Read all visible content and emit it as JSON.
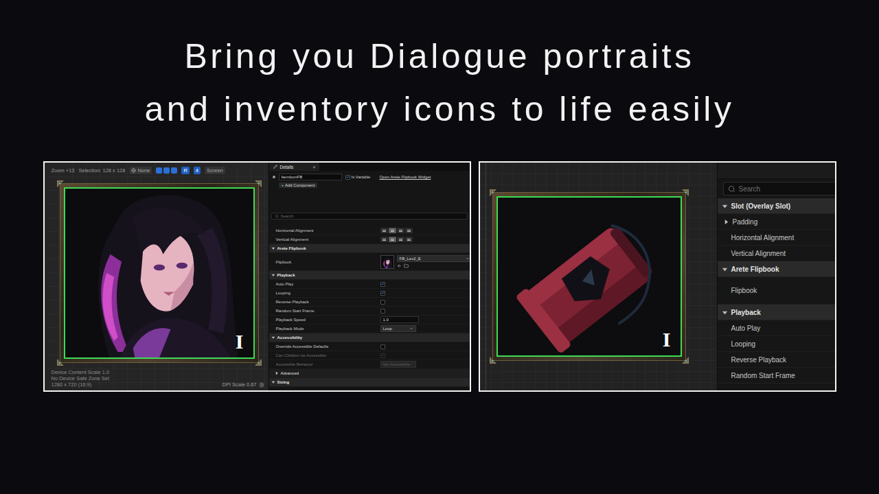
{
  "headline": {
    "lines": [
      "Bring you Dialogue portraits",
      "and inventory icons to life easily"
    ]
  },
  "portrait_shot": {
    "toolbar": {
      "zoom": "Zoom +13",
      "selection": "Selection: 128 x 128",
      "items": [
        {
          "label": "None",
          "selected": false
        },
        {
          "label": "R",
          "selected": true
        },
        {
          "label": "4",
          "selected": true
        },
        {
          "label": "Screen",
          "selected": false
        }
      ],
      "toggles": [
        {
          "selected": true
        },
        {
          "selected": true
        },
        {
          "selected": true
        }
      ]
    },
    "cursor": "I",
    "viewport_info": [
      "Device Content Scale 1.0",
      "No Device Safe Zone Set",
      "1280 x 720 (16:9)"
    ],
    "dpi_scale": "DPI Scale 0.67",
    "details": {
      "tab": {
        "label": "Details",
        "close": "×"
      },
      "widget_name": "ItemIconFB",
      "is_variable": {
        "label": "Is Variable",
        "checked": true
      },
      "open_link": "Open Arete Flipbook Widget",
      "add_component": {
        "icon": "+",
        "label": "Add Component"
      },
      "search": {
        "placeholder": "Search"
      },
      "rows": [
        {
          "kind": "align",
          "label": "Horizontal Alignment",
          "options": [
            {
              "selected": false
            },
            {
              "selected": true
            },
            {
              "selected": false
            },
            {
              "selected": false
            }
          ]
        },
        {
          "kind": "align",
          "label": "Vertical Alignment",
          "options": [
            {
              "selected": false
            },
            {
              "selected": true
            },
            {
              "selected": false
            },
            {
              "selected": false
            }
          ]
        },
        {
          "kind": "section",
          "label": "Arete Flipbook",
          "expanded": true
        },
        {
          "kind": "asset",
          "label": "Flipbook",
          "value": "FB_Lex2_E"
        },
        {
          "kind": "section",
          "label": "Playback",
          "expanded": true
        },
        {
          "kind": "checkbox",
          "label": "Auto Play",
          "checked": true,
          "disabled": false
        },
        {
          "kind": "checkbox",
          "label": "Looping",
          "checked": true,
          "disabled": false
        },
        {
          "kind": "checkbox",
          "label": "Reverse Playback",
          "checked": false,
          "disabled": false
        },
        {
          "kind": "checkbox",
          "label": "Random Start Frame",
          "checked": false,
          "disabled": false
        },
        {
          "kind": "number",
          "label": "Playback Speed",
          "value": "1.0",
          "disabled": false
        },
        {
          "kind": "dropdown",
          "label": "Playback Mode",
          "value": "Loop",
          "disabled": false
        },
        {
          "kind": "section",
          "label": "Accessibility",
          "expanded": true
        },
        {
          "kind": "checkbox",
          "label": "Override Accessible Defaults",
          "checked": false,
          "disabled": false
        },
        {
          "kind": "checkbox",
          "label": "Can Children be Accessible",
          "checked": true,
          "disabled": true
        },
        {
          "kind": "dropdown",
          "label": "Accessible Behavior",
          "value": "Not Accessible",
          "disabled": true
        },
        {
          "kind": "subsection",
          "label": "Advanced",
          "expanded": false
        },
        {
          "kind": "section",
          "label": "Sizing",
          "expanded": true
        }
      ]
    }
  },
  "icon_shot": {
    "cursor": "I",
    "search": {
      "placeholder": "Search"
    },
    "rows": [
      {
        "kind": "section",
        "label": "Slot (Overlay Slot)",
        "expanded": true
      },
      {
        "kind": "subsection",
        "label": "Padding",
        "expanded": false
      },
      {
        "kind": "property",
        "label": "Horizontal Alignment"
      },
      {
        "kind": "property",
        "label": "Vertical Alignment"
      },
      {
        "kind": "section",
        "label": "Arete Flipbook",
        "expanded": true
      },
      {
        "kind": "asset",
        "label": "Flipbook"
      },
      {
        "kind": "section",
        "label": "Playback",
        "expanded": true
      },
      {
        "kind": "property",
        "label": "Auto Play"
      },
      {
        "kind": "property",
        "label": "Looping"
      },
      {
        "kind": "property",
        "label": "Reverse Playback"
      },
      {
        "kind": "property",
        "label": "Random Start Frame"
      }
    ]
  }
}
